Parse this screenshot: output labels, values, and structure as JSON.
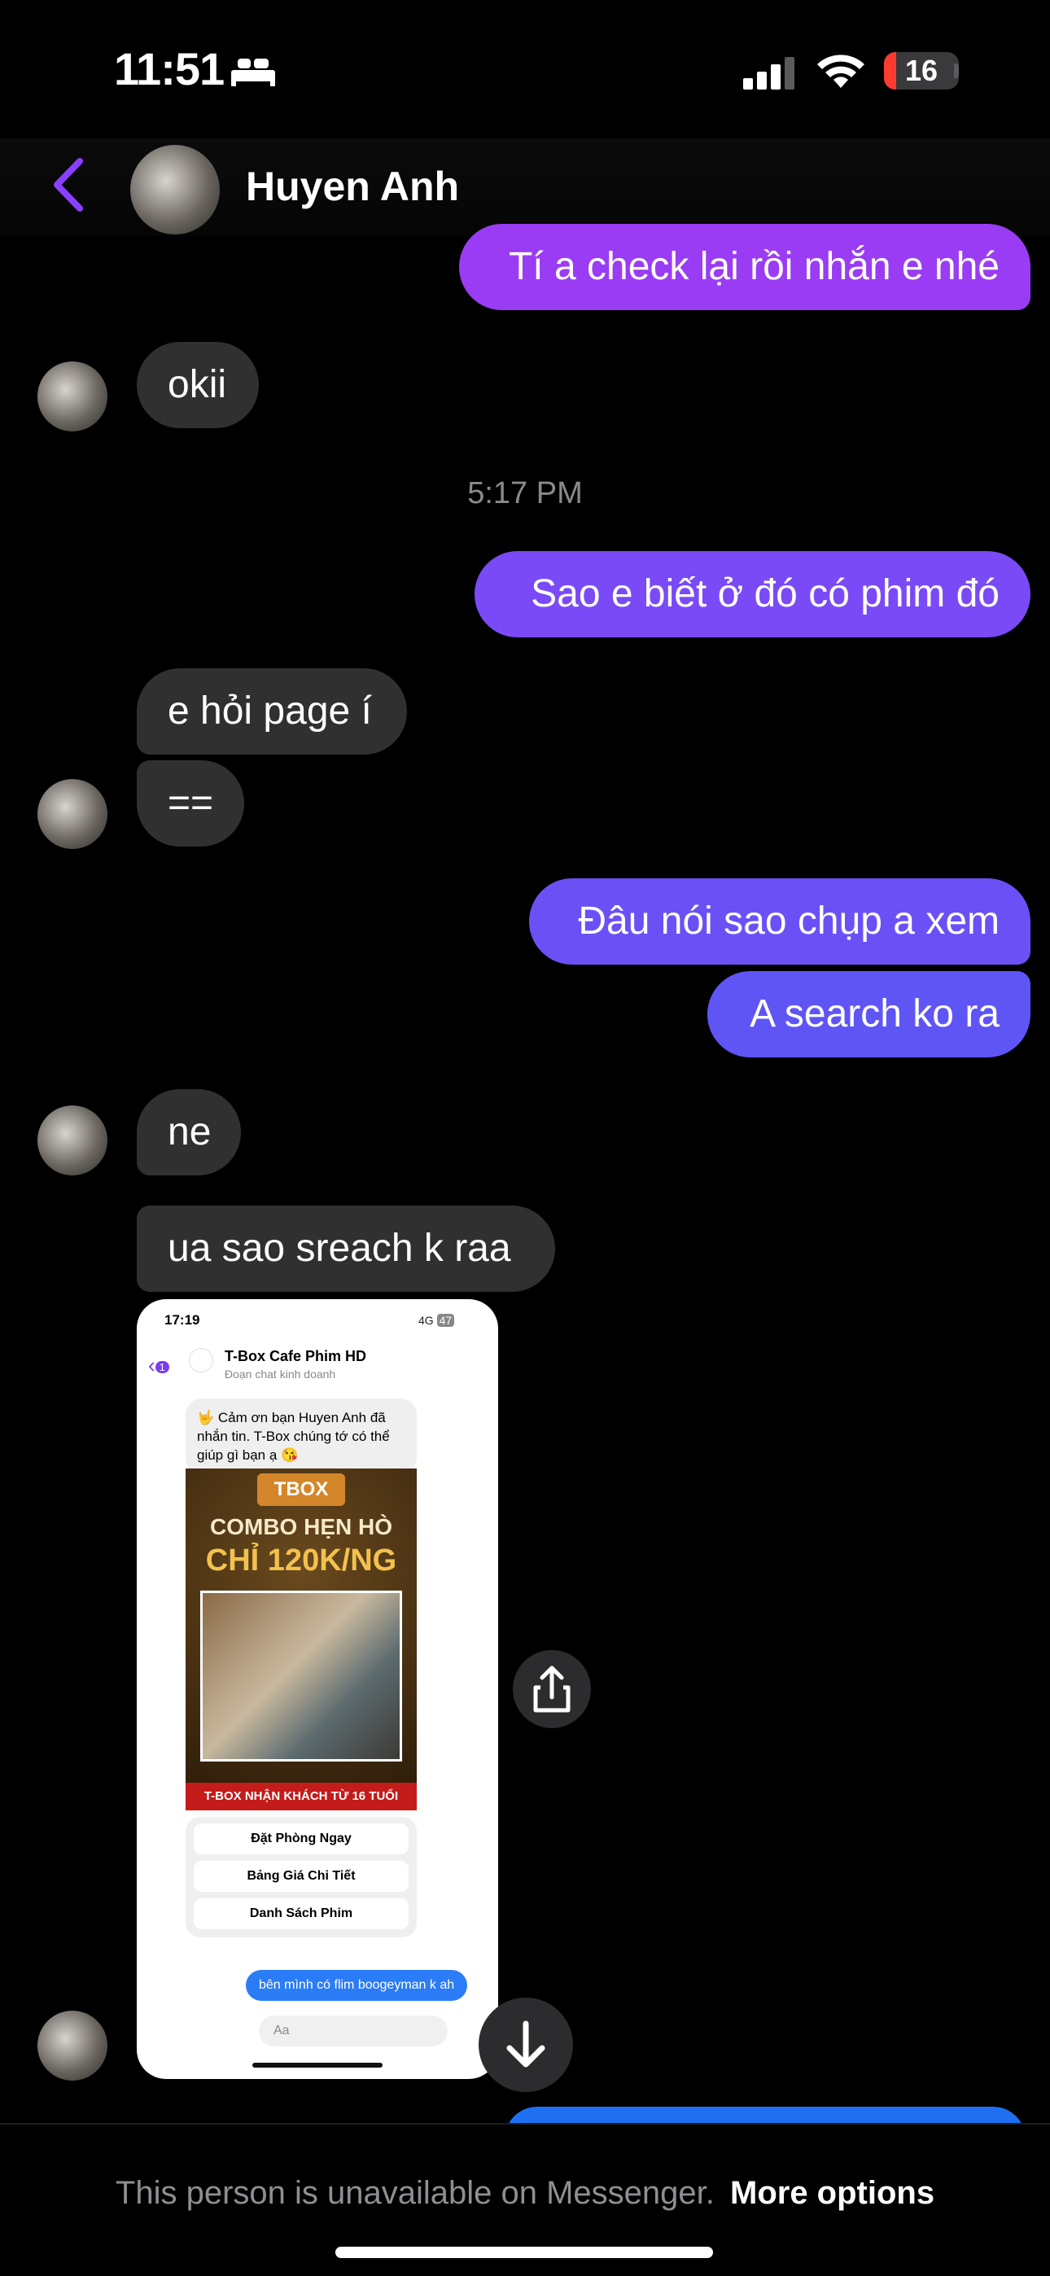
{
  "status_bar": {
    "time": "11:51",
    "battery": "16",
    "battery_level": 0.16
  },
  "header": {
    "contact_name": "Huyen Anh"
  },
  "messages": {
    "m1": "Tí a check lại rồi nhắn e nhé",
    "m2": "okii",
    "timestamp": "5:17 PM",
    "m3": "Sao e biết ở đó có phim đó",
    "m4": "e hỏi page í",
    "m5": "==",
    "m6": "Đâu nói sao chụp a xem",
    "m7": "A search ko ra",
    "m8": "ne",
    "m9": "ua sao sreach k raa"
  },
  "attachment": {
    "time": "17:19",
    "network": "4G",
    "battery": "47",
    "back_count": "1",
    "page_name": "T-Box Cafe Phim HD",
    "page_subtitle": "Đoạn chat kinh doanh",
    "welcome": "🤟 Cảm ơn bạn Huyen Anh đã nhắn tin. T-Box chúng tớ có thể giúp gì bạn ạ 😘",
    "brand": "TBOX",
    "combo": "COMBO HẸN HÒ",
    "price": "CHỈ 120K/NG",
    "age_notice": "T-BOX NHẬN KHÁCH TỪ 16 TUỔI",
    "buttons": [
      "Đặt Phòng Ngay",
      "Bảng Giá Chi Tiết",
      "Danh Sách Phim"
    ],
    "my_message": "bên mình có flim boogeyman k ah",
    "input_placeholder": "Aa"
  },
  "footer": {
    "message": "This person is unavailable on Messenger.",
    "link": "More options"
  },
  "colors": {
    "accent": "#8a3ffc",
    "outgoing_gradient_top": "#9a3cf4",
    "outgoing_gradient_bottom": "#5b55f5",
    "incoming": "#303030"
  }
}
